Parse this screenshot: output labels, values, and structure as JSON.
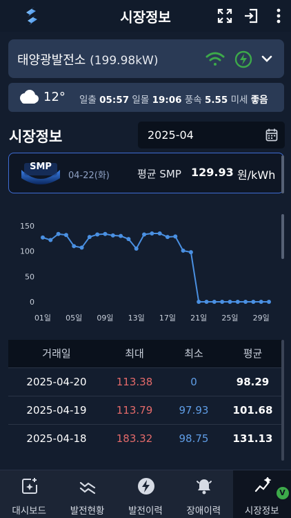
{
  "header": {
    "title": "시장정보"
  },
  "plant": {
    "name": "태양광발전소",
    "capacity": "(199.98kW)"
  },
  "weather": {
    "temperature": "12°",
    "sunrise_label": "일출",
    "sunrise": "05:57",
    "sunset_label": "일몰",
    "sunset": "19:06",
    "wind_label": "풍속",
    "wind": "5.55",
    "dust_label": "미세",
    "dust": "좋음"
  },
  "section": {
    "title": "시장정보",
    "date_value": "2025-04"
  },
  "smp": {
    "badge": "SMP",
    "date": "04-22(화)",
    "label": "평균 SMP",
    "value": "129.93",
    "unit": "원/kWh"
  },
  "chart_data": {
    "type": "line",
    "x_ticks": [
      "01일",
      "05일",
      "09일",
      "13일",
      "17일",
      "21일",
      "25일",
      "29일"
    ],
    "y_ticks": [
      "0",
      "50",
      "100",
      "150"
    ],
    "ylim": [
      0,
      150
    ],
    "x": [
      1,
      2,
      3,
      4,
      5,
      6,
      7,
      8,
      9,
      10,
      11,
      12,
      13,
      14,
      15,
      16,
      17,
      18,
      19,
      20,
      21,
      22,
      23,
      24,
      25,
      26,
      27,
      28,
      29,
      30
    ],
    "values": [
      127,
      122,
      134,
      132,
      110,
      107,
      128,
      133,
      134,
      131,
      130,
      124,
      105,
      133,
      135,
      135,
      128,
      129,
      101,
      98,
      0,
      0,
      0,
      0,
      0,
      0,
      0,
      0,
      0,
      0
    ],
    "color": "#4a90e2"
  },
  "table": {
    "headers": [
      "거래일",
      "최대",
      "최소",
      "평균"
    ],
    "rows": [
      {
        "date": "2025-04-20",
        "max": "113.38",
        "min": "0",
        "avg": "98.29"
      },
      {
        "date": "2025-04-19",
        "max": "113.79",
        "min": "97.93",
        "avg": "101.68"
      },
      {
        "date": "2025-04-18",
        "max": "183.32",
        "min": "98.75",
        "avg": "131.13"
      }
    ]
  },
  "nav": {
    "items": [
      {
        "label": "대시보드"
      },
      {
        "label": "발전현황"
      },
      {
        "label": "발전이력"
      },
      {
        "label": "장애이력"
      },
      {
        "label": "시장정보"
      }
    ],
    "badge": "V"
  },
  "colors": {
    "accent": "#3f6dd6",
    "wifi": "#3daa4a",
    "max": "#e46a6a",
    "min": "#5f9de6"
  }
}
